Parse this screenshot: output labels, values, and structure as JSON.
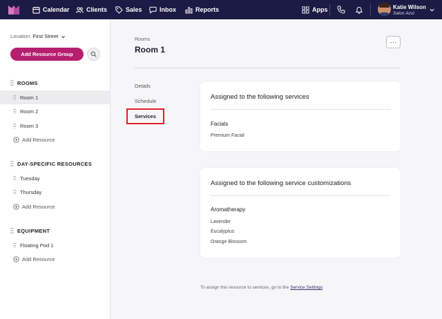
{
  "colors": {
    "nav_bg": "#1c1b45",
    "brand": "#b61f6e",
    "highlight_box": "#e01d2a",
    "logo": "#b04a9e"
  },
  "nav": {
    "logo_icon": "mindbody-logo-icon",
    "items": [
      {
        "label": "Calendar",
        "icon": "calendar-icon"
      },
      {
        "label": "Clients",
        "icon": "clients-icon"
      },
      {
        "label": "Sales",
        "icon": "tag-icon"
      },
      {
        "label": "Inbox",
        "icon": "chat-icon"
      },
      {
        "label": "Reports",
        "icon": "bar-chart-icon"
      }
    ],
    "apps_label": "Apps",
    "user": {
      "name": "Katie Wilson",
      "salon": "Salon Azul"
    }
  },
  "sidebar": {
    "location_label": "Location:",
    "location_value": "First Street",
    "add_group_label": "Add Resource Group",
    "sections": [
      {
        "title": "ROOMS",
        "items": [
          "Room 1",
          "Room 2",
          "Room 3"
        ],
        "add_label": "Add Resource"
      },
      {
        "title": "DAY-SPECIFIC RESOURCES",
        "items": [
          "Tuesday",
          "Thursday"
        ],
        "add_label": "Add Resource"
      },
      {
        "title": "EQUIPMENT",
        "items": [
          "Floating Pod 1"
        ],
        "add_label": "Add Resource"
      }
    ],
    "selected_item": "Room 1"
  },
  "main": {
    "breadcrumb": "Rooms",
    "title": "Room 1",
    "more_label": "···",
    "tabs": [
      "Details",
      "Schedule",
      "Services"
    ],
    "active_tab": "Services",
    "cards": [
      {
        "title": "Assigned to the following services",
        "group": "Facials",
        "lines": [
          "Premium Facial"
        ]
      },
      {
        "title": "Assigned to the following service customizations",
        "group": "Aromatherapy",
        "lines": [
          "Lavender",
          "Eucalyptus",
          "Orange Blossom"
        ]
      }
    ],
    "footer_text": "To assign this resource to services, go to the",
    "footer_link": "Service Settings",
    "footer_end": "."
  }
}
